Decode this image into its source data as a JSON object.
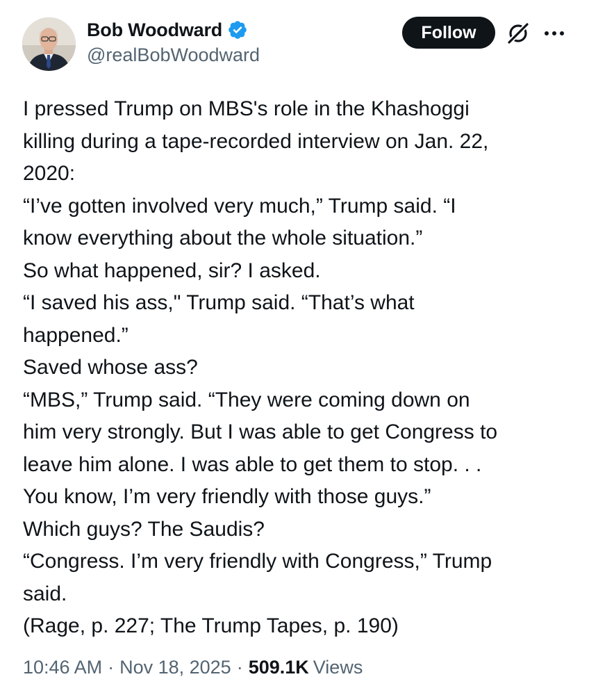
{
  "author": {
    "display_name": "Bob Woodward",
    "handle": "@realBobWoodward",
    "verified": true,
    "verified_color": "#1d9bf0"
  },
  "header": {
    "follow_label": "Follow",
    "grok_icon": "grok-icon",
    "more_icon": "more-horizontal-icon"
  },
  "post": {
    "lines": [
      "I pressed Trump on MBS's role in the Khashoggi",
      "killing during a tape-recorded interview on  Jan. 22,",
      "2020:",
      "“I’ve gotten involved very much,” Trump said. “I",
      "know everything about the whole situation.”",
      "So what happened, sir? I asked.",
      "“I saved his ass,\" Trump said. “That’s what",
      "happened.”",
      "Saved whose ass?",
      "“MBS,” Trump said. “They were coming down on",
      "him very strongly. But I was able to get Congress to",
      "leave him alone. I was able to get them to stop. . .",
      "You know, I’m very friendly with those guys.”",
      "Which guys? The Saudis?",
      "“Congress. I’m very friendly with Congress,” Trump",
      "said.",
      "(Rage, p. 227; The Trump Tapes, p. 190)"
    ]
  },
  "meta": {
    "time": "10:46 AM",
    "separator": "·",
    "date": "Nov 18, 2025",
    "views_count": "509.1K",
    "views_label": "Views"
  }
}
